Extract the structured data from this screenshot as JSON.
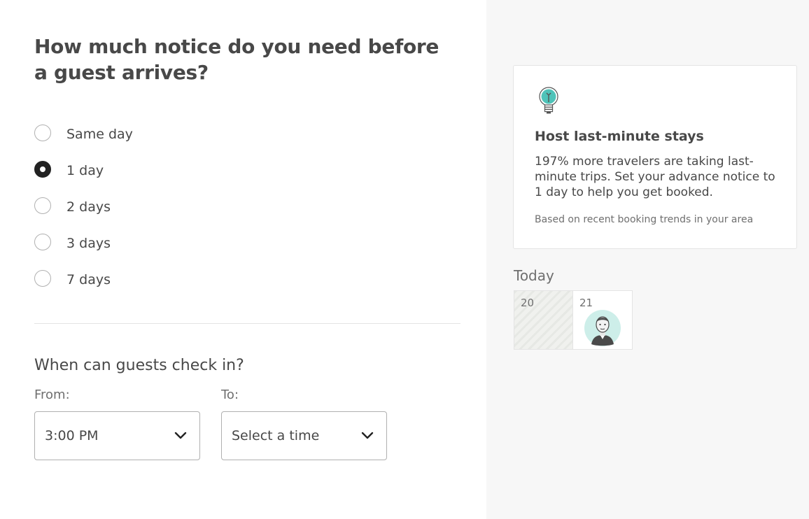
{
  "notice": {
    "heading": "How much notice do you need before a guest arrives?",
    "selected": "1 day",
    "options": [
      {
        "label": "Same day",
        "checked": false
      },
      {
        "label": "1 day",
        "checked": true
      },
      {
        "label": "2 days",
        "checked": false
      },
      {
        "label": "3 days",
        "checked": false
      },
      {
        "label": "7 days",
        "checked": false
      }
    ]
  },
  "checkin": {
    "heading": "When can guests check in?",
    "from_label": "From:",
    "from_value": "3:00 PM",
    "to_label": "To:",
    "to_value": "Select a time"
  },
  "tip": {
    "icon": "lightbulb-icon",
    "title": "Host last-minute stays",
    "body": "197% more travelers are taking last-minute trips. Set your advance notice to 1 day to help you get booked.",
    "footnote": "Based on recent booking trends in your area"
  },
  "calendar": {
    "today_label": "Today",
    "days": [
      {
        "num": "20",
        "blocked": true
      },
      {
        "num": "21",
        "blocked": false,
        "guest": "guest-avatar"
      }
    ]
  },
  "colors": {
    "text": "#484848",
    "muted": "#6f6f6f",
    "border": "#b0b0b0",
    "panel_bg": "#f7f7f7",
    "accent_teal": "#4fc3b9"
  }
}
